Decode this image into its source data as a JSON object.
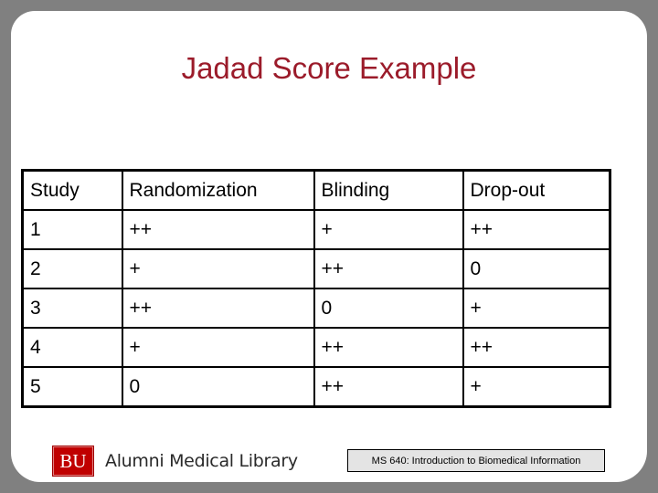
{
  "slide": {
    "title": "Jadad Score Example",
    "title_color": "#9b1b2a"
  },
  "table": {
    "headers": [
      "Study",
      "Randomization",
      "Blinding",
      "Drop-out"
    ],
    "rows": [
      [
        "1",
        "++",
        "+",
        "++"
      ],
      [
        "2",
        "+",
        "++",
        "0"
      ],
      [
        "3",
        "++",
        "0",
        "+"
      ],
      [
        "4",
        "+",
        "++",
        "++"
      ],
      [
        "5",
        "0",
        "++",
        "+"
      ]
    ]
  },
  "footer": {
    "logo_text": "BU",
    "logo_color": "#c00000",
    "library_name": "Alumni Medical Library",
    "course_label": "MS 640: Introduction to Biomedical Information"
  }
}
